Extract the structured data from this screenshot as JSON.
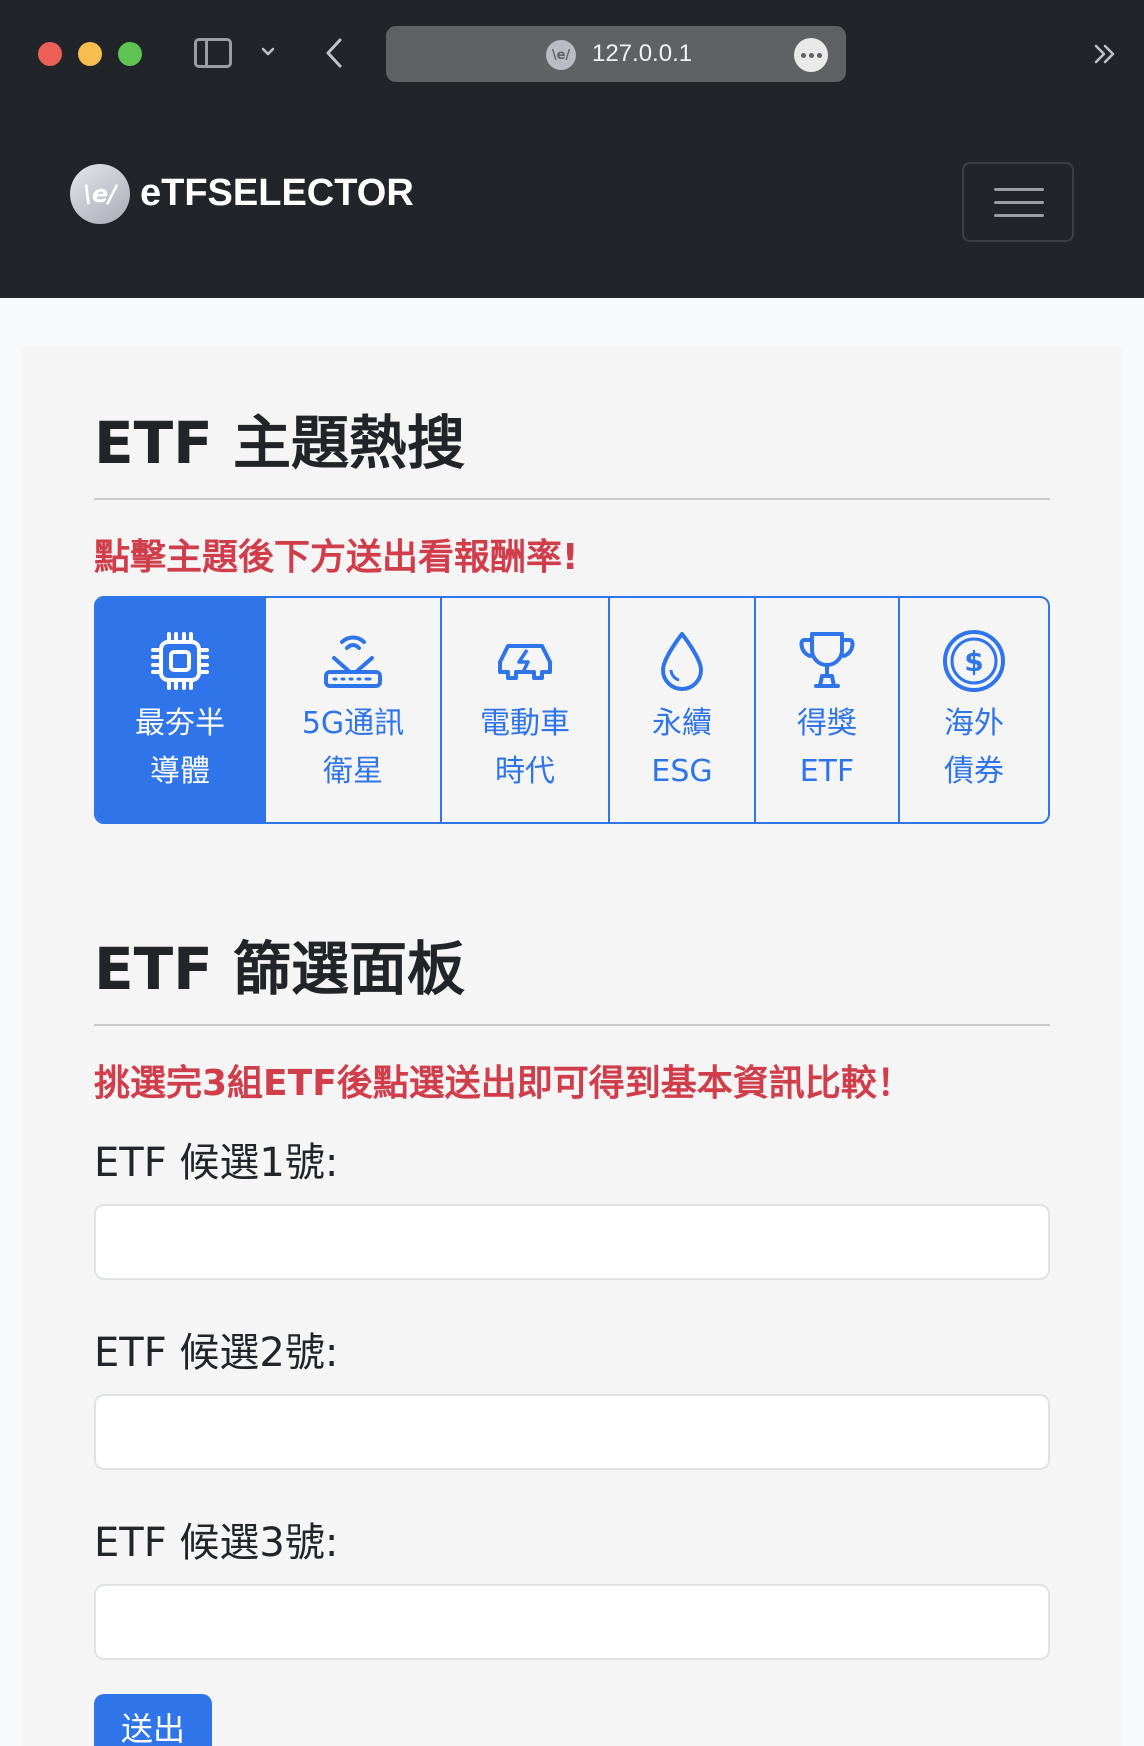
{
  "browser": {
    "url": "127.0.0.1",
    "favicon_text": "\\e/"
  },
  "navbar": {
    "logo_text": "\\e/",
    "brand": "eTFSELECTOR"
  },
  "theme_section": {
    "title": "ETF 主題熱搜",
    "hint": "點擊主題後下方送出看報酬率!",
    "themes": [
      {
        "label": "最夯半\n導體",
        "icon": "cpu-icon",
        "active": true
      },
      {
        "label": "5G通訊\n衛星",
        "icon": "router-icon",
        "active": false
      },
      {
        "label": "電動車\n時代",
        "icon": "ev-car-icon",
        "active": false
      },
      {
        "label": "永續\nESG",
        "icon": "droplet-icon",
        "active": false
      },
      {
        "label": "得獎\nETF",
        "icon": "trophy-icon",
        "active": false
      },
      {
        "label": "海外\n債券",
        "icon": "dollar-coin-icon",
        "active": false
      }
    ]
  },
  "filter_section": {
    "title": "ETF 篩選面板",
    "hint": "挑選完3組ETF後點選送出即可得到基本資訊比較！",
    "fields": [
      {
        "label": "ETF 候選1號:",
        "value": ""
      },
      {
        "label": "ETF 候選2號:",
        "value": ""
      },
      {
        "label": "ETF 候選3號:",
        "value": ""
      }
    ],
    "submit_label": "送出"
  },
  "colors": {
    "primary": "#2f74e8",
    "danger": "#d03d4b",
    "dark": "#212529"
  }
}
